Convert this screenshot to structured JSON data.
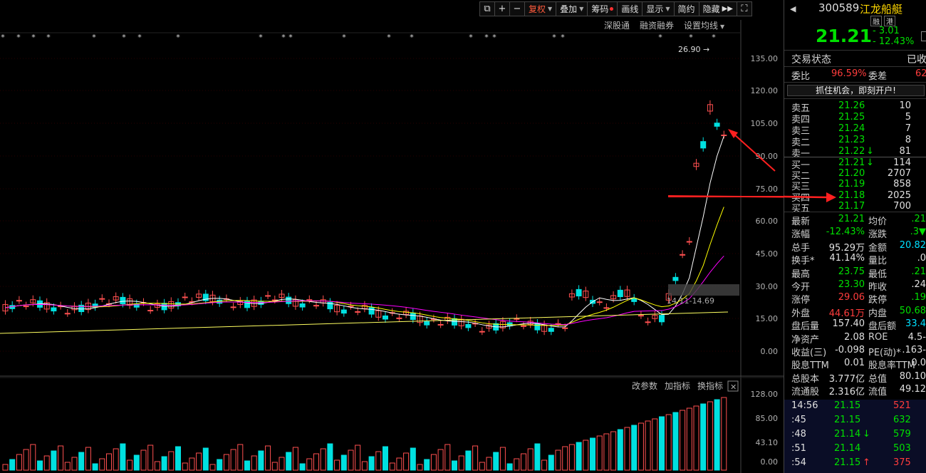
{
  "toolbar": {
    "buttons": [
      "复权",
      "叠加",
      "筹码",
      "画线",
      "显示",
      "简约",
      "隐藏"
    ],
    "icon_labels": [
      "⧉",
      "+",
      "−"
    ]
  },
  "subtools": [
    "深股通",
    "融资融券",
    "设置均线"
  ],
  "chart": {
    "peak_label": "26.90",
    "range_label": "14.11-14.69",
    "y_ticks": [
      "135.00",
      "120.00",
      "105.00",
      "90.00",
      "75.00",
      "60.00",
      "45.00",
      "30.00",
      "15.00",
      "0.00"
    ],
    "sub_y_ticks": [
      "128.00",
      "85.00",
      "43.10",
      "0.00"
    ],
    "sub_tools": [
      "改参数",
      "加指标",
      "换指标"
    ],
    "colors": {
      "up": "#ff5050",
      "down": "#00e0e0",
      "ma5": "#ffffff",
      "ma10": "#ffff00",
      "ma20": "#ff00ff",
      "ma60": "#ffff60"
    }
  },
  "quote": {
    "code": "300589",
    "name": "江龙船艇",
    "tags": [
      "融",
      "港"
    ],
    "price": "21.21",
    "change": "- 3.01",
    "change_pct": "- 12.43%"
  },
  "status": {
    "label": "交易状态",
    "value": "已收"
  },
  "ratio": {
    "label1": "委比",
    "value1": "96.59%",
    "label2": "委差",
    "value2": "62"
  },
  "banner": "抓住机会，即刻开户!",
  "asks": [
    {
      "label": "卖五",
      "price": "21.26",
      "vol": "10",
      "arrow": ""
    },
    {
      "label": "卖四",
      "price": "21.25",
      "vol": "5",
      "arrow": ""
    },
    {
      "label": "卖三",
      "price": "21.24",
      "vol": "7",
      "arrow": ""
    },
    {
      "label": "卖二",
      "price": "21.23",
      "vol": "8",
      "arrow": ""
    },
    {
      "label": "卖一",
      "price": "21.22",
      "vol": "81",
      "arrow": "↓"
    }
  ],
  "bids": [
    {
      "label": "买一",
      "price": "21.21",
      "vol": "114",
      "arrow": "↓"
    },
    {
      "label": "买二",
      "price": "21.20",
      "vol": "2707",
      "arrow": ""
    },
    {
      "label": "买三",
      "price": "21.19",
      "vol": "858",
      "arrow": ""
    },
    {
      "label": "买四",
      "price": "21.18",
      "vol": "2025",
      "arrow": ""
    },
    {
      "label": "买五",
      "price": "21.17",
      "vol": "700",
      "arrow": ""
    }
  ],
  "stats": [
    [
      {
        "l": "最新",
        "v": "21.21",
        "c": "g"
      },
      {
        "l": "均价",
        "v": "21.",
        "c": "g"
      }
    ],
    [
      {
        "l": "涨幅",
        "v": "-12.43%",
        "c": "g"
      },
      {
        "l": "涨跌",
        "v": "▼3.",
        "c": "g"
      }
    ],
    [
      {
        "l": "总手",
        "v": "95.29万",
        "c": "w"
      },
      {
        "l": "金额",
        "v": "20.82",
        "c": "c"
      }
    ],
    [
      {
        "l": "换手*",
        "v": "41.14%",
        "c": "w"
      },
      {
        "l": "量比",
        "v": "0.",
        "c": "w"
      }
    ],
    [
      {
        "l": "最高",
        "v": "23.75",
        "c": "g"
      },
      {
        "l": "最低",
        "v": "21.",
        "c": "g"
      }
    ],
    [
      {
        "l": "今开",
        "v": "23.30",
        "c": "g"
      },
      {
        "l": "昨收",
        "v": "24.",
        "c": "w"
      }
    ],
    [
      {
        "l": "涨停",
        "v": "29.06",
        "c": "r"
      },
      {
        "l": "跌停",
        "v": "19.",
        "c": "g"
      }
    ],
    [
      {
        "l": "外盘",
        "v": "44.61万",
        "c": "r"
      },
      {
        "l": "内盘",
        "v": "50.68",
        "c": "g"
      }
    ],
    [
      {
        "l": "盘后量",
        "v": "157.40",
        "c": "w"
      },
      {
        "l": "盘后额",
        "v": "33.4",
        "c": "c"
      }
    ],
    [
      {
        "l": "净资产",
        "v": "2.08",
        "c": "w"
      },
      {
        "l": "ROE",
        "v": "-4.5",
        "c": "w"
      }
    ],
    [
      {
        "l": "收益(三)",
        "v": "-0.098",
        "c": "w"
      },
      {
        "l": "PE(动)*",
        "v": "-163.",
        "c": "w"
      }
    ],
    [
      {
        "l": "股息TTM",
        "v": "0.01",
        "c": "w"
      },
      {
        "l": "股息率TTM",
        "v": "0.0",
        "c": "w"
      }
    ],
    [
      {
        "l": "总股本",
        "v": "3.777亿",
        "c": "w"
      },
      {
        "l": "总值",
        "v": "80.10",
        "c": "w"
      }
    ],
    [
      {
        "l": "流通股",
        "v": "2.316亿",
        "c": "w"
      },
      {
        "l": "流值",
        "v": "49.12",
        "c": "w"
      }
    ]
  ],
  "trades": [
    {
      "t": "14:56",
      "p": "21.15",
      "v": "521",
      "vc": "r",
      "a": ""
    },
    {
      "t": ":45",
      "p": "21.15",
      "v": "632",
      "vc": "g",
      "a": ""
    },
    {
      "t": ":48",
      "p": "21.14",
      "v": "579",
      "vc": "g",
      "a": "↓"
    },
    {
      "t": ":51",
      "p": "21.14",
      "v": "503",
      "vc": "g",
      "a": ""
    },
    {
      "t": ":54",
      "p": "21.15",
      "v": "375",
      "vc": "r",
      "a": "↑"
    }
  ]
}
